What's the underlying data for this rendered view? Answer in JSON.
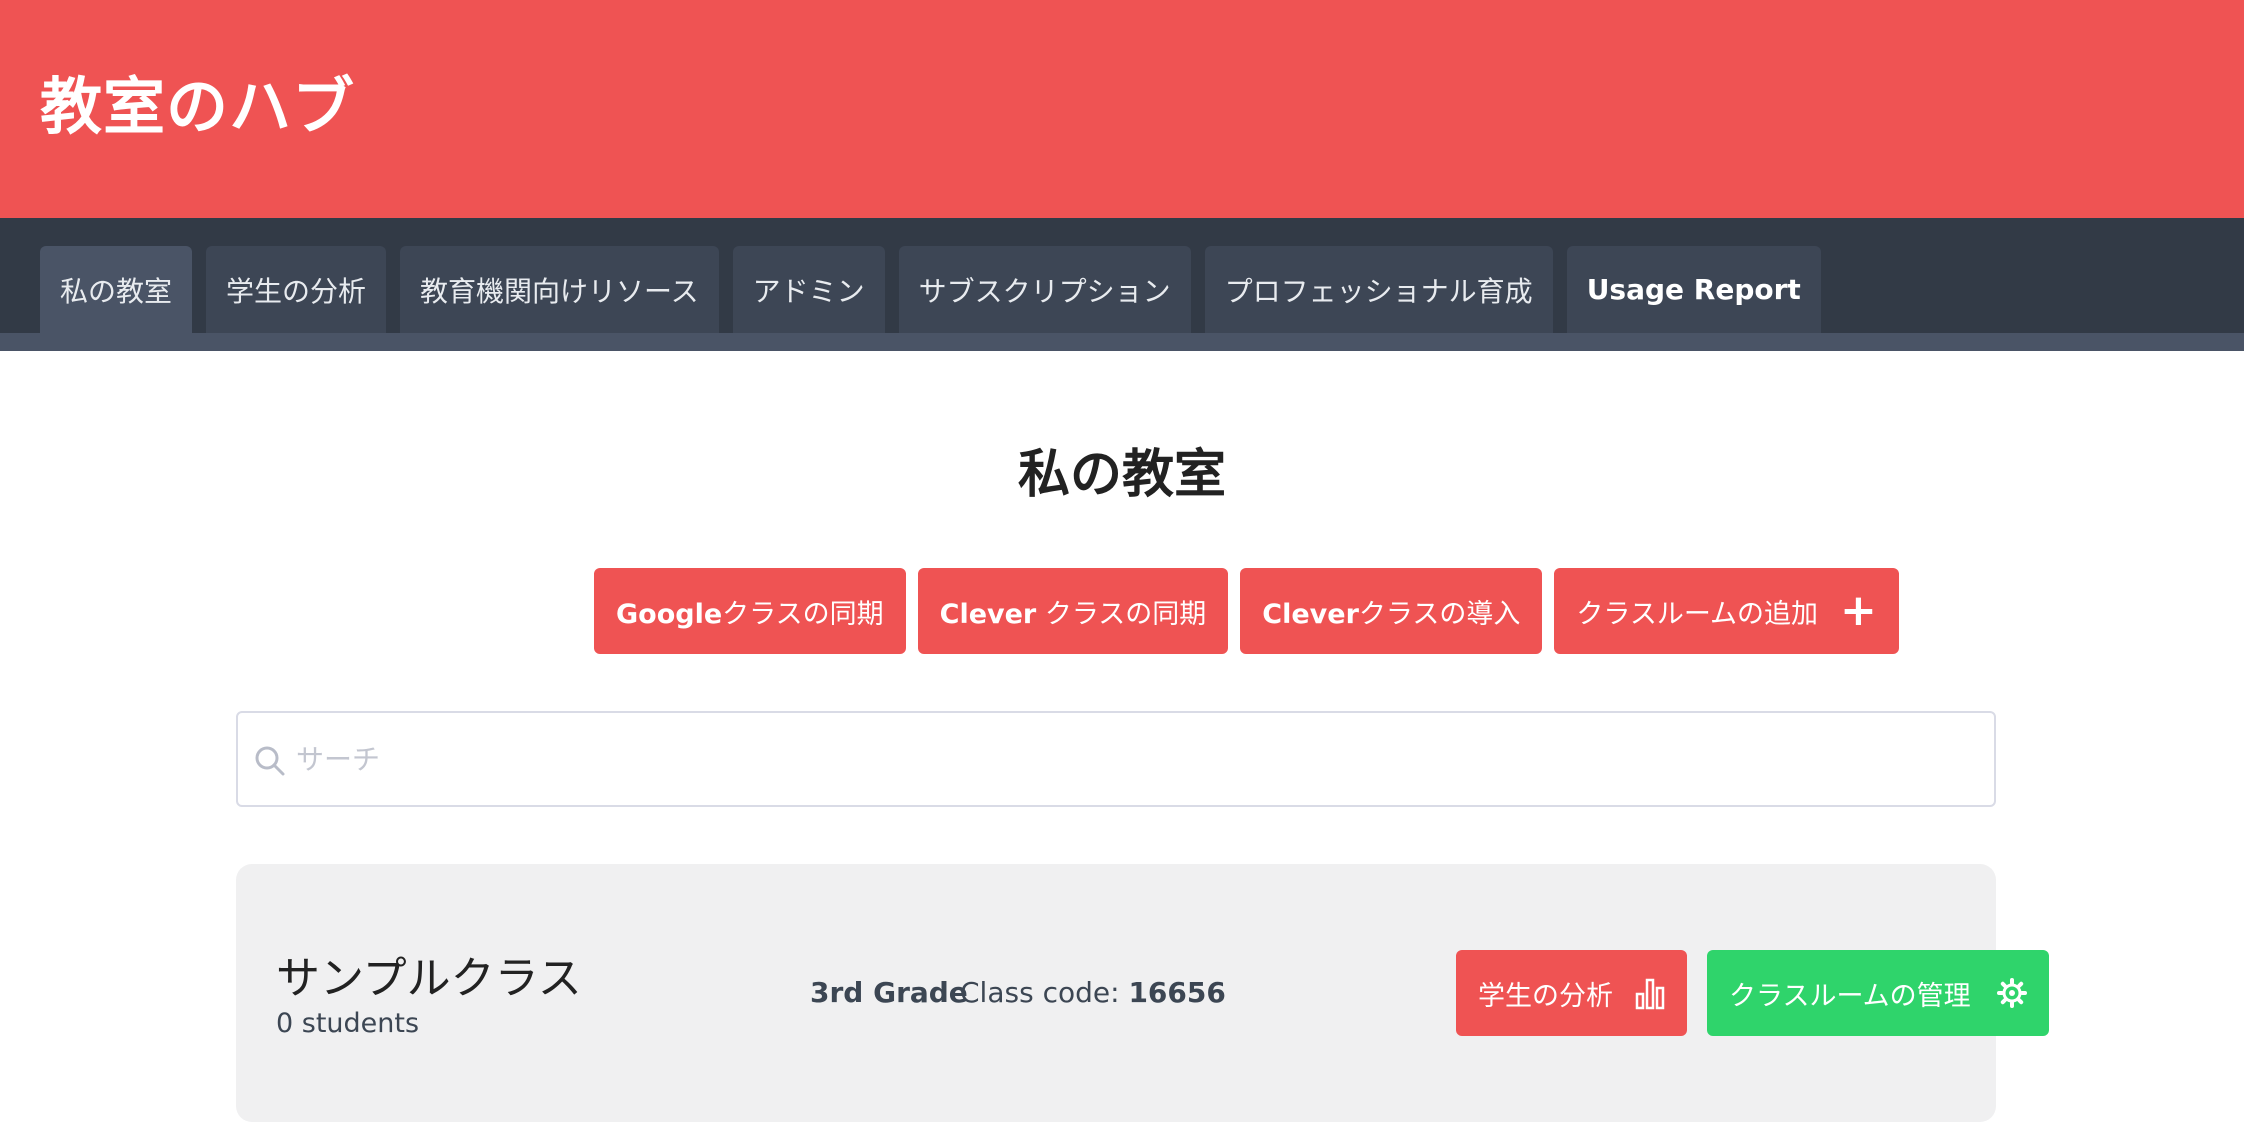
{
  "header": {
    "brand": "教室のハブ"
  },
  "nav": {
    "tabs": [
      {
        "label": "私の教室",
        "active": true
      },
      {
        "label": "学生の分析"
      },
      {
        "label": "教育機関向けリソース"
      },
      {
        "label": "アドミン"
      },
      {
        "label": "サブスクリプション"
      },
      {
        "label": "プロフェッショナル育成"
      },
      {
        "label": "Usage Report"
      }
    ]
  },
  "page": {
    "title": "私の教室"
  },
  "actions": {
    "google_sync": {
      "brand": "Google",
      "text": "クラスの同期"
    },
    "clever_sync": {
      "brand": "Clever",
      "text": " クラスの同期"
    },
    "clever_import": {
      "brand": "Clever",
      "text": "クラスの導入"
    },
    "add_classroom": {
      "text": "クラスルームの追加",
      "icon": "plus-icon"
    }
  },
  "search": {
    "placeholder": "サーチ",
    "value": "",
    "icon": "search-icon"
  },
  "classes": [
    {
      "name": "サンプルクラス",
      "students": "0 students",
      "grade": "3rd Grade",
      "code_label": "Class code: ",
      "code": "16656",
      "analytics_button": {
        "label": "学生の分析",
        "icon": "bar-chart-icon"
      },
      "manage_button": {
        "label": "クラスルームの管理",
        "icon": "gear-icon"
      }
    }
  ],
  "colors": {
    "header_bg": "#ef5353",
    "nav_bg": "#323a46",
    "tab_bg": "#3d4655",
    "tab_active_bg": "#4a5466",
    "primary_button": "#ef5353",
    "success_button": "#2fd46b",
    "card_bg": "#f0f0f1"
  }
}
